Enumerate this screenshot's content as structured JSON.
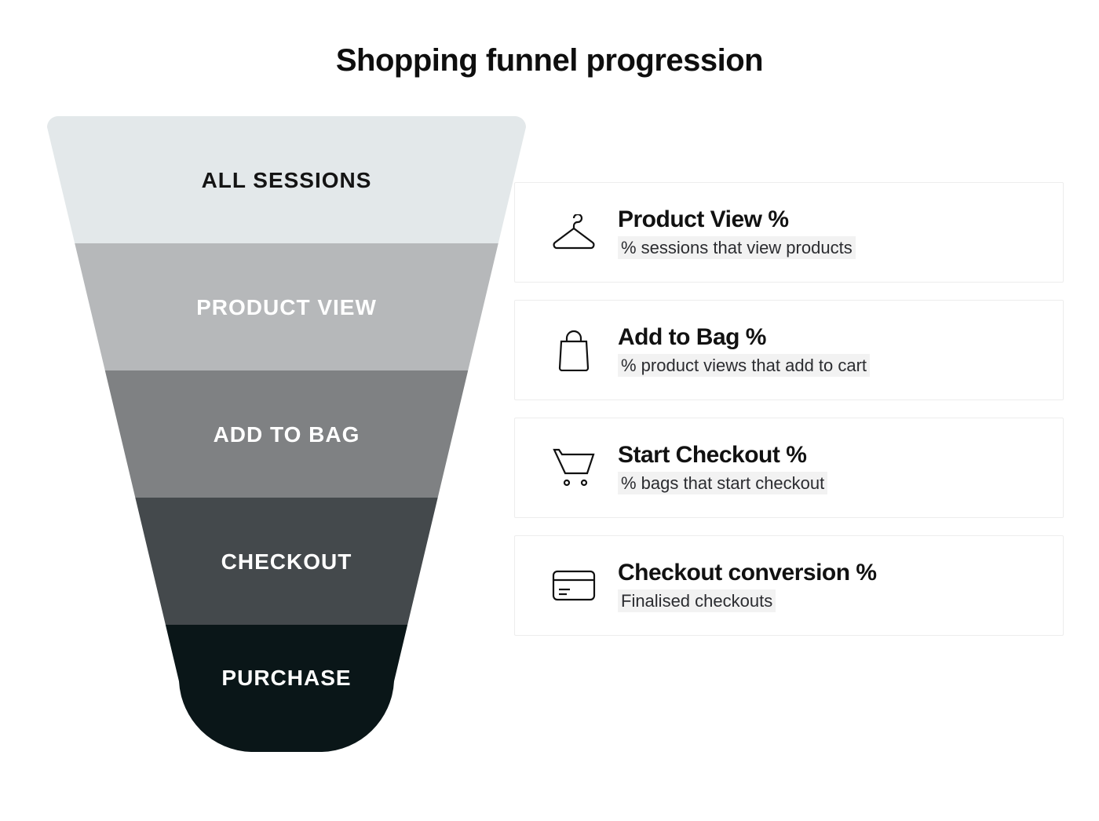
{
  "title": "Shopping funnel progression",
  "funnel": {
    "stages": [
      {
        "label": "ALL SESSIONS",
        "fill": "#e3e8ea",
        "text": "dark"
      },
      {
        "label": "PRODUCT VIEW",
        "fill": "#b6b8ba",
        "text": "light"
      },
      {
        "label": "ADD TO BAG",
        "fill": "#7f8183",
        "text": "light"
      },
      {
        "label": "CHECKOUT",
        "fill": "#44494c",
        "text": "light"
      },
      {
        "label": "PURCHASE",
        "fill": "#0a1618",
        "text": "light"
      }
    ]
  },
  "cards": [
    {
      "icon": "hanger",
      "title": "Product View %",
      "sub": "% sessions that view products"
    },
    {
      "icon": "bag",
      "title": "Add to Bag %",
      "sub": "% product views that add to cart"
    },
    {
      "icon": "cart",
      "title": "Start Checkout %",
      "sub": "% bags that start checkout"
    },
    {
      "icon": "card",
      "title": "Checkout conversion %",
      "sub": "Finalised checkouts"
    }
  ]
}
